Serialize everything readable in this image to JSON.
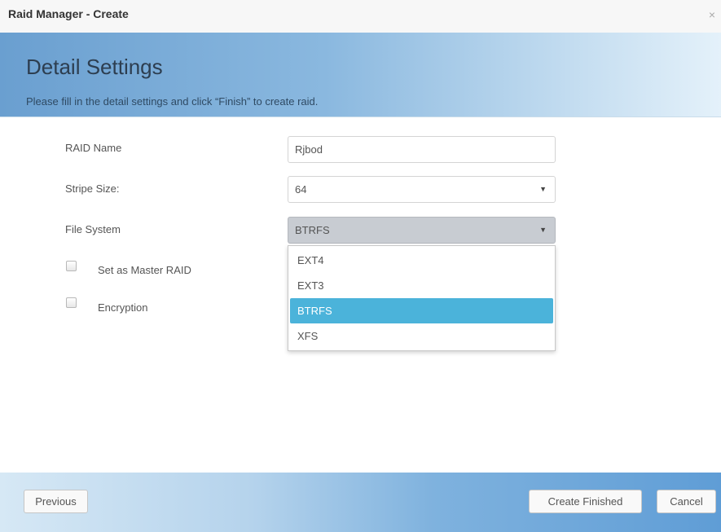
{
  "window": {
    "title": "Raid Manager - Create",
    "close_glyph": "×"
  },
  "header": {
    "title": "Detail Settings",
    "subtitle": "Please fill in the detail settings and click “Finish” to create raid."
  },
  "form": {
    "raid_name_label": "RAID Name",
    "raid_name_value": "Rjbod",
    "stripe_size_label": "Stripe Size:",
    "stripe_size_value": "64",
    "file_system_label": "File System",
    "file_system_value": "BTRFS",
    "file_system_options": [
      "EXT4",
      "EXT3",
      "BTRFS",
      "XFS"
    ],
    "selected_option": "BTRFS",
    "master_raid_label": "Set as Master RAID",
    "master_raid_checked": false,
    "encryption_label": "Encryption",
    "encryption_checked": false,
    "dropdown_arrow": "▼"
  },
  "footer": {
    "previous_label": "Previous",
    "create_label": "Create Finished",
    "cancel_label": "Cancel"
  },
  "icons": {
    "close": "close-icon",
    "dropdown": "chevron-down-icon"
  },
  "colors": {
    "header_gradient_start": "#6a9fd0",
    "header_gradient_end": "#e4f1fa",
    "selected_option_bg": "#4bb3da",
    "footer_gradient_end": "#5f9dd6"
  }
}
